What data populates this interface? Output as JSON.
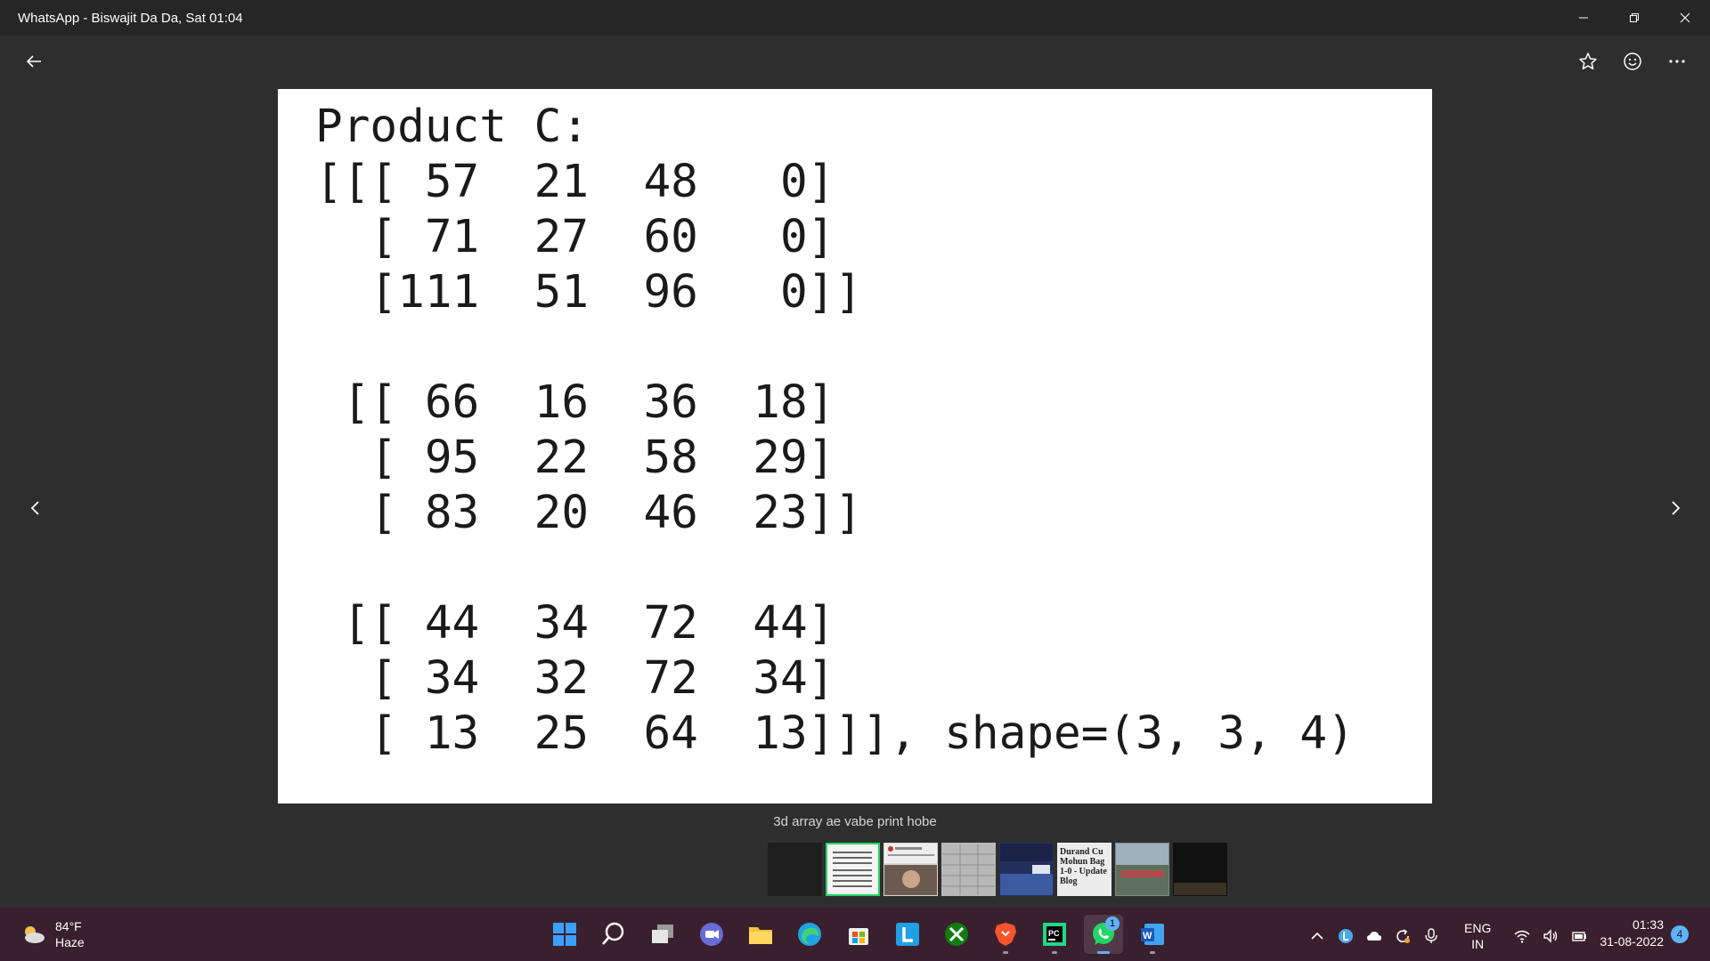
{
  "window": {
    "title": "WhatsApp - Biswajit Da Da, Sat 01:04"
  },
  "viewer": {
    "code_text": "Product C:\n[[[ 57  21  48   0]\n  [ 71  27  60   0]\n  [111  51  96   0]]\n\n [[ 66  16  36  18]\n  [ 95  22  58  29]\n  [ 83  20  46  23]]\n\n [[ 44  34  72  44]\n  [ 34  32  72  34]\n  [ 13  25  64  13]]], shape=(3, 3, 4)",
    "caption": "3d array ae vabe print hobe",
    "thumbnails": [
      {
        "name": "dark-screen",
        "text": "",
        "selected": false
      },
      {
        "name": "array-output",
        "text": "",
        "selected": true
      },
      {
        "name": "news-portrait",
        "text": "",
        "selected": false
      },
      {
        "name": "document-grid",
        "text": "",
        "selected": false
      },
      {
        "name": "stadium-match",
        "text": "",
        "selected": false
      },
      {
        "name": "blog-headline",
        "text": "Durand Cu Mohun Bag 1-0 - Update Blog",
        "selected": false
      },
      {
        "name": "crowd-photo",
        "text": "",
        "selected": false
      },
      {
        "name": "dark-video",
        "text": "",
        "selected": false
      }
    ]
  },
  "taskbar": {
    "weather_temp": "84°F",
    "weather_desc": "Haze",
    "apps": [
      {
        "name": "start",
        "active": false,
        "running": false,
        "badge": ""
      },
      {
        "name": "search",
        "active": false,
        "running": false,
        "badge": ""
      },
      {
        "name": "task-view",
        "active": false,
        "running": false,
        "badge": ""
      },
      {
        "name": "teams-chat",
        "active": false,
        "running": false,
        "badge": ""
      },
      {
        "name": "file-explorer",
        "active": false,
        "running": false,
        "badge": ""
      },
      {
        "name": "edge",
        "active": false,
        "running": false,
        "badge": ""
      },
      {
        "name": "microsoft-store",
        "active": false,
        "running": false,
        "badge": ""
      },
      {
        "name": "l-app",
        "active": false,
        "running": false,
        "badge": ""
      },
      {
        "name": "xbox",
        "active": false,
        "running": false,
        "badge": ""
      },
      {
        "name": "brave",
        "active": false,
        "running": true,
        "badge": ""
      },
      {
        "name": "pycharm",
        "active": false,
        "running": true,
        "badge": ""
      },
      {
        "name": "whatsapp",
        "active": true,
        "running": true,
        "badge": "1"
      },
      {
        "name": "word",
        "active": false,
        "running": true,
        "badge": ""
      }
    ],
    "lang_line1": "ENG",
    "lang_line2": "IN",
    "time": "01:33",
    "date": "31-08-2022",
    "notification_count": "4"
  },
  "colors": {
    "whatsapp_green": "#25d366",
    "accent_blue": "#5fb2ff",
    "taskbar_bg": "#3a1f2e"
  }
}
